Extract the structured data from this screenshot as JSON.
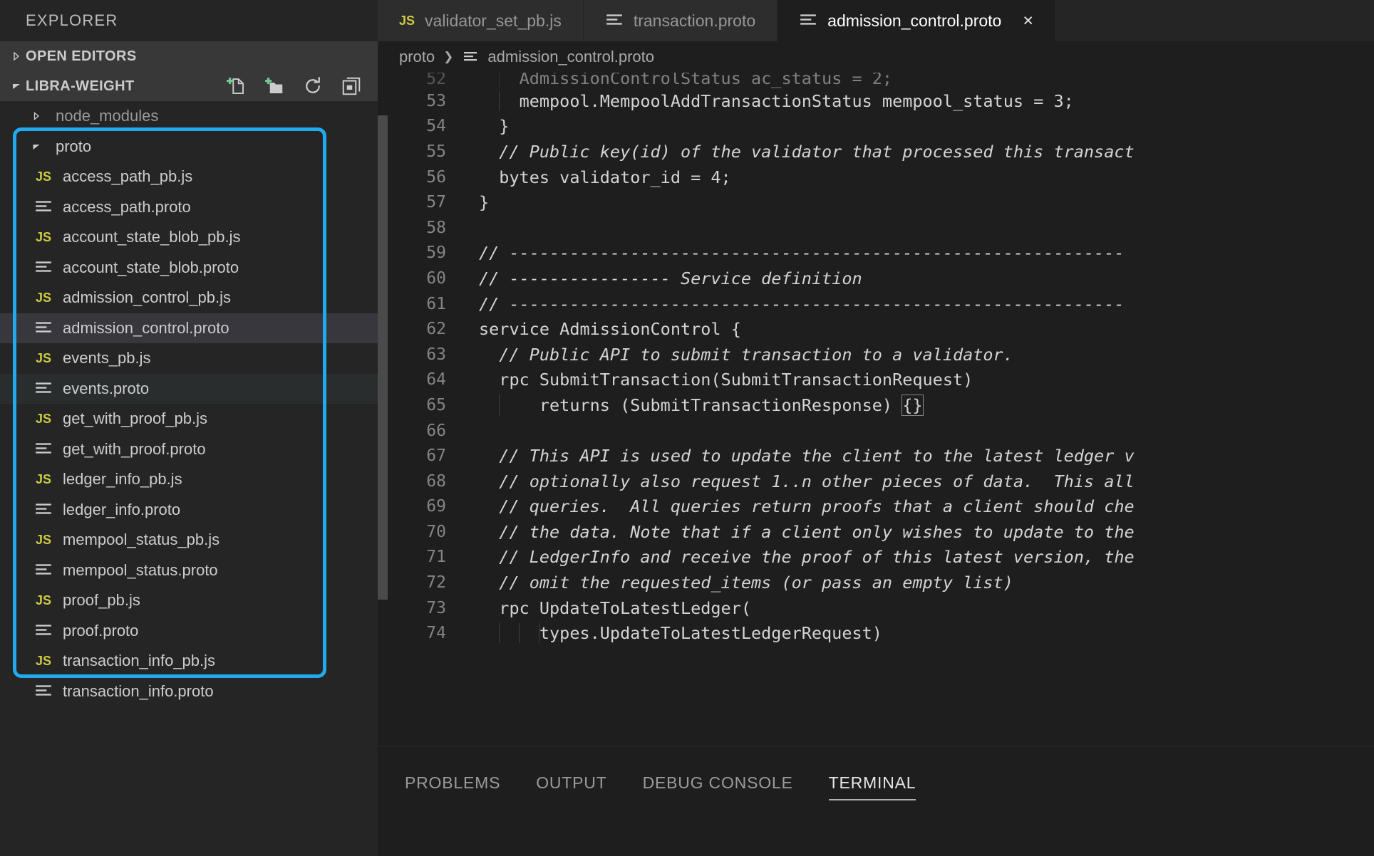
{
  "sidebar": {
    "title": "EXPLORER",
    "sections": [
      {
        "label": "OPEN EDITORS",
        "expanded": false
      },
      {
        "label": "LIBRA-WEIGHT",
        "expanded": true
      }
    ],
    "actions": [
      {
        "name": "new-file-icon",
        "tooltip": "New File"
      },
      {
        "name": "new-folder-icon",
        "tooltip": "New Folder"
      },
      {
        "name": "refresh-icon",
        "tooltip": "Refresh Explorer"
      },
      {
        "name": "collapse-all-icon",
        "tooltip": "Collapse Folders in Explorer"
      }
    ],
    "tree": [
      {
        "label": "node_modules",
        "kind": "folder",
        "expanded": false,
        "depth": 1,
        "state": "dim"
      },
      {
        "label": "proto",
        "kind": "folder",
        "expanded": true,
        "depth": 1,
        "state": "normal"
      },
      {
        "label": "access_path_pb.js",
        "kind": "js",
        "depth": 2,
        "state": "normal"
      },
      {
        "label": "access_path.proto",
        "kind": "proto",
        "depth": 2,
        "state": "normal"
      },
      {
        "label": "account_state_blob_pb.js",
        "kind": "js",
        "depth": 2,
        "state": "normal"
      },
      {
        "label": "account_state_blob.proto",
        "kind": "proto",
        "depth": 2,
        "state": "normal"
      },
      {
        "label": "admission_control_pb.js",
        "kind": "js",
        "depth": 2,
        "state": "normal"
      },
      {
        "label": "admission_control.proto",
        "kind": "proto",
        "depth": 2,
        "state": "selected"
      },
      {
        "label": "events_pb.js",
        "kind": "js",
        "depth": 2,
        "state": "normal"
      },
      {
        "label": "events.proto",
        "kind": "proto",
        "depth": 2,
        "state": "hovered"
      },
      {
        "label": "get_with_proof_pb.js",
        "kind": "js",
        "depth": 2,
        "state": "normal"
      },
      {
        "label": "get_with_proof.proto",
        "kind": "proto",
        "depth": 2,
        "state": "normal"
      },
      {
        "label": "ledger_info_pb.js",
        "kind": "js",
        "depth": 2,
        "state": "normal"
      },
      {
        "label": "ledger_info.proto",
        "kind": "proto",
        "depth": 2,
        "state": "normal"
      },
      {
        "label": "mempool_status_pb.js",
        "kind": "js",
        "depth": 2,
        "state": "normal"
      },
      {
        "label": "mempool_status.proto",
        "kind": "proto",
        "depth": 2,
        "state": "normal"
      },
      {
        "label": "proof_pb.js",
        "kind": "js",
        "depth": 2,
        "state": "normal"
      },
      {
        "label": "proof.proto",
        "kind": "proto",
        "depth": 2,
        "state": "normal"
      },
      {
        "label": "transaction_info_pb.js",
        "kind": "js",
        "depth": 2,
        "state": "normal"
      },
      {
        "label": "transaction_info.proto",
        "kind": "proto",
        "depth": 2,
        "state": "normal"
      }
    ],
    "highlight": {
      "color": "#22aaee",
      "from": "proto",
      "to": "transaction_info_pb.js"
    }
  },
  "tabs": [
    {
      "label": "validator_set_pb.js",
      "icon": "js",
      "active": false,
      "closable": false
    },
    {
      "label": "transaction.proto",
      "icon": "proto",
      "active": false,
      "closable": false
    },
    {
      "label": "admission_control.proto",
      "icon": "proto",
      "active": true,
      "closable": true,
      "close_glyph": "×"
    }
  ],
  "breadcrumb": {
    "folder": "proto",
    "separator": "❯",
    "file": "admission_control.proto"
  },
  "editor": {
    "first_partial_line": {
      "num": "52",
      "text": "    AdmissionControlStatus ac_status = 2;"
    },
    "lines": [
      {
        "num": "53",
        "text": "    mempool.MempoolAddTransactionStatus mempool_status = 3;",
        "type": "code",
        "guides": 1
      },
      {
        "num": "54",
        "text": "  }",
        "type": "code",
        "guides": 0
      },
      {
        "num": "55",
        "text": "  // Public key(id) of the validator that processed this transact",
        "type": "comment",
        "guides": 0
      },
      {
        "num": "56",
        "text": "  bytes validator_id = 4;",
        "type": "code",
        "guides": 0
      },
      {
        "num": "57",
        "text": "}",
        "type": "code",
        "guides": 0
      },
      {
        "num": "58",
        "text": "",
        "type": "code",
        "guides": 0
      },
      {
        "num": "59",
        "text": "// -------------------------------------------------------------",
        "type": "comment",
        "guides": 0
      },
      {
        "num": "60",
        "text": "// ---------------- Service definition",
        "type": "comment",
        "guides": 0
      },
      {
        "num": "61",
        "text": "// -------------------------------------------------------------",
        "type": "comment",
        "guides": 0
      },
      {
        "num": "62",
        "text": "service AdmissionControl {",
        "type": "code",
        "guides": 0
      },
      {
        "num": "63",
        "text": "  // Public API to submit transaction to a validator.",
        "type": "comment",
        "guides": 0
      },
      {
        "num": "64",
        "text": "  rpc SubmitTransaction(SubmitTransactionRequest)",
        "type": "code",
        "guides": 0
      },
      {
        "num": "65",
        "text": "      returns (SubmitTransactionResponse) ",
        "type": "code",
        "guides": 1,
        "bracket": "{}"
      },
      {
        "num": "66",
        "text": "",
        "type": "code",
        "guides": 1
      },
      {
        "num": "67",
        "text": "  // This API is used to update the client to the latest ledger v",
        "type": "comment",
        "guides": 0
      },
      {
        "num": "68",
        "text": "  // optionally also request 1..n other pieces of data.  This all",
        "type": "comment",
        "guides": 0
      },
      {
        "num": "69",
        "text": "  // queries.  All queries return proofs that a client should che",
        "type": "comment",
        "guides": 0
      },
      {
        "num": "70",
        "text": "  // the data. Note that if a client only wishes to update to the",
        "type": "comment",
        "guides": 0
      },
      {
        "num": "71",
        "text": "  // LedgerInfo and receive the proof of this latest version, the",
        "type": "comment",
        "guides": 0
      },
      {
        "num": "72",
        "text": "  // omit the requested_items (or pass an empty list)",
        "type": "comment",
        "guides": 0
      },
      {
        "num": "73",
        "text": "  rpc UpdateToLatestLedger(",
        "type": "code",
        "guides": 0
      },
      {
        "num": "74",
        "text": "      types.UpdateToLatestLedgerRequest)",
        "type": "code",
        "guides": 3
      }
    ]
  },
  "panel": {
    "tabs": [
      {
        "label": "PROBLEMS",
        "active": false
      },
      {
        "label": "OUTPUT",
        "active": false
      },
      {
        "label": "DEBUG CONSOLE",
        "active": false
      },
      {
        "label": "TERMINAL",
        "active": true
      }
    ]
  },
  "colors": {
    "accent": "#22aaee",
    "sidebar_bg": "#252526",
    "editor_bg": "#1e1e1e",
    "js_badge": "#cbcb41",
    "new_icon_green": "#73c991"
  }
}
